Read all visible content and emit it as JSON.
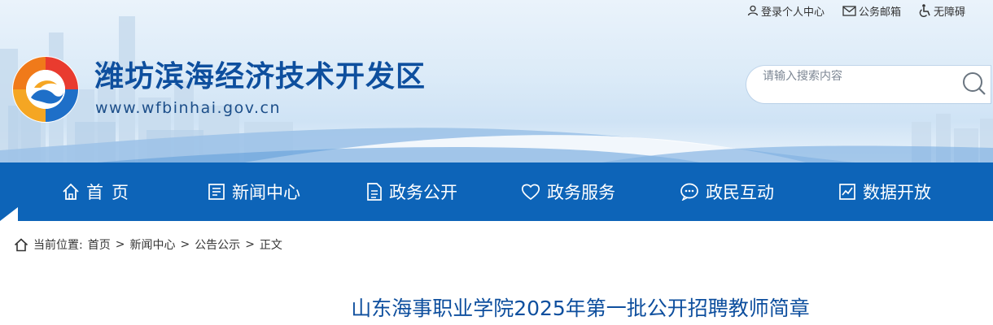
{
  "topbar": {
    "login": "登录个人中心",
    "mail": "公务邮箱",
    "accessibility": "无障碍"
  },
  "site": {
    "title": "潍坊滨海经济技术开发区",
    "url": "www.wfbinhai.gov.cn"
  },
  "search": {
    "placeholder": "请输入搜索内容"
  },
  "nav": {
    "items": [
      {
        "label": "首页",
        "icon": "home-icon"
      },
      {
        "label": "新闻中心",
        "icon": "news-icon"
      },
      {
        "label": "政务公开",
        "icon": "document-icon"
      },
      {
        "label": "政务服务",
        "icon": "heart-icon"
      },
      {
        "label": "政民互动",
        "icon": "chat-icon"
      },
      {
        "label": "数据开放",
        "icon": "chart-icon"
      }
    ]
  },
  "breadcrumb": {
    "prefix": "当前位置:",
    "items": [
      "首页",
      "新闻中心",
      "公告公示",
      "正文"
    ],
    "separator": ">"
  },
  "article": {
    "title": "山东海事职业学院2025年第一批公开招聘教师简章"
  },
  "colors": {
    "nav_bg": "#0d64b8",
    "title_blue": "#0e4f9e"
  }
}
